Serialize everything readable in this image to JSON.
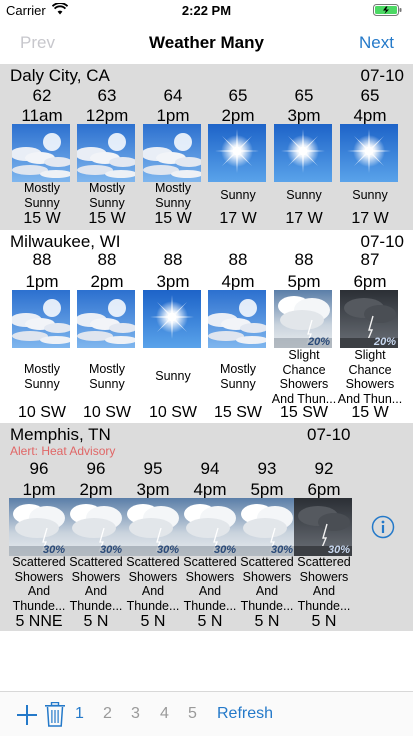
{
  "status": {
    "carrier": "Carrier",
    "time": "2:22 PM"
  },
  "nav": {
    "prev": "Prev",
    "title": "Weather Many",
    "next": "Next"
  },
  "locations": [
    {
      "city": "Daly City, CA",
      "date": "07-10",
      "alert": "",
      "hours": [
        {
          "temp": "62",
          "time": "11am",
          "icon": "partly-sunny",
          "precip": "",
          "desc": [
            "Mostly",
            "Sunny"
          ],
          "wind": "15 W"
        },
        {
          "temp": "63",
          "time": "12pm",
          "icon": "partly-sunny",
          "precip": "",
          "desc": [
            "Mostly",
            "Sunny"
          ],
          "wind": "15 W"
        },
        {
          "temp": "64",
          "time": "1pm",
          "icon": "partly-sunny",
          "precip": "",
          "desc": [
            "Mostly",
            "Sunny"
          ],
          "wind": "15 W"
        },
        {
          "temp": "65",
          "time": "2pm",
          "icon": "sunny",
          "precip": "",
          "desc": [
            "Sunny"
          ],
          "wind": "17 W"
        },
        {
          "temp": "65",
          "time": "3pm",
          "icon": "sunny",
          "precip": "",
          "desc": [
            "Sunny"
          ],
          "wind": "17 W"
        },
        {
          "temp": "65",
          "time": "4pm",
          "icon": "sunny",
          "precip": "",
          "desc": [
            "Sunny"
          ],
          "wind": "17 W"
        }
      ]
    },
    {
      "city": "Milwaukee, WI",
      "date": "07-10",
      "alert": "",
      "hours": [
        {
          "temp": "88",
          "time": "1pm",
          "icon": "partly-sunny",
          "precip": "",
          "desc": [
            "Mostly",
            "Sunny"
          ],
          "wind": "10 SW"
        },
        {
          "temp": "88",
          "time": "2pm",
          "icon": "partly-sunny",
          "precip": "",
          "desc": [
            "Mostly",
            "Sunny"
          ],
          "wind": "10 SW"
        },
        {
          "temp": "88",
          "time": "3pm",
          "icon": "sunny",
          "precip": "",
          "desc": [
            "Sunny"
          ],
          "wind": "10 SW"
        },
        {
          "temp": "88",
          "time": "4pm",
          "icon": "partly-sunny",
          "precip": "",
          "desc": [
            "Mostly",
            "Sunny"
          ],
          "wind": "15 SW"
        },
        {
          "temp": "88",
          "time": "5pm",
          "icon": "storm-day",
          "precip": "20%",
          "desc": [
            "Slight",
            "Chance",
            "Showers",
            "And Thun..."
          ],
          "wind": "15 SW"
        },
        {
          "temp": "87",
          "time": "6pm",
          "icon": "storm-night",
          "precip": "20%",
          "desc": [
            "Slight",
            "Chance",
            "Showers",
            "And Thun..."
          ],
          "wind": "15 W"
        }
      ]
    },
    {
      "city": "Memphis, TN",
      "date": "07-10",
      "alert": "Alert: Heat Advisory",
      "hours": [
        {
          "temp": "96",
          "time": "1pm",
          "icon": "storm-day",
          "precip": "30%",
          "desc": [
            "Scattered",
            "Showers",
            "And",
            "Thunde..."
          ],
          "wind": "5 NNE"
        },
        {
          "temp": "96",
          "time": "2pm",
          "icon": "storm-day",
          "precip": "30%",
          "desc": [
            "Scattered",
            "Showers",
            "And",
            "Thunde..."
          ],
          "wind": "5 N"
        },
        {
          "temp": "95",
          "time": "3pm",
          "icon": "storm-day",
          "precip": "30%",
          "desc": [
            "Scattered",
            "Showers",
            "And",
            "Thunde..."
          ],
          "wind": "5 N"
        },
        {
          "temp": "94",
          "time": "4pm",
          "icon": "storm-day",
          "precip": "30%",
          "desc": [
            "Scattered",
            "Showers",
            "And",
            "Thunde..."
          ],
          "wind": "5 N"
        },
        {
          "temp": "93",
          "time": "5pm",
          "icon": "storm-day",
          "precip": "30%",
          "desc": [
            "Scattered",
            "Showers",
            "And",
            "Thunde..."
          ],
          "wind": "5 N"
        },
        {
          "temp": "92",
          "time": "6pm",
          "icon": "storm-night",
          "precip": "30%",
          "desc": [
            "Scattered",
            "Showers",
            "And",
            "Thunde..."
          ],
          "wind": "5 N"
        }
      ]
    }
  ],
  "toolbar": {
    "pages": [
      "1",
      "2",
      "3",
      "4",
      "5"
    ],
    "active_page": "1",
    "refresh": "Refresh"
  },
  "colors": {
    "accent": "#2479c9",
    "alert": "#e06666",
    "disabled": "#c7c7cc",
    "section_grey": "#dcdcdc"
  }
}
